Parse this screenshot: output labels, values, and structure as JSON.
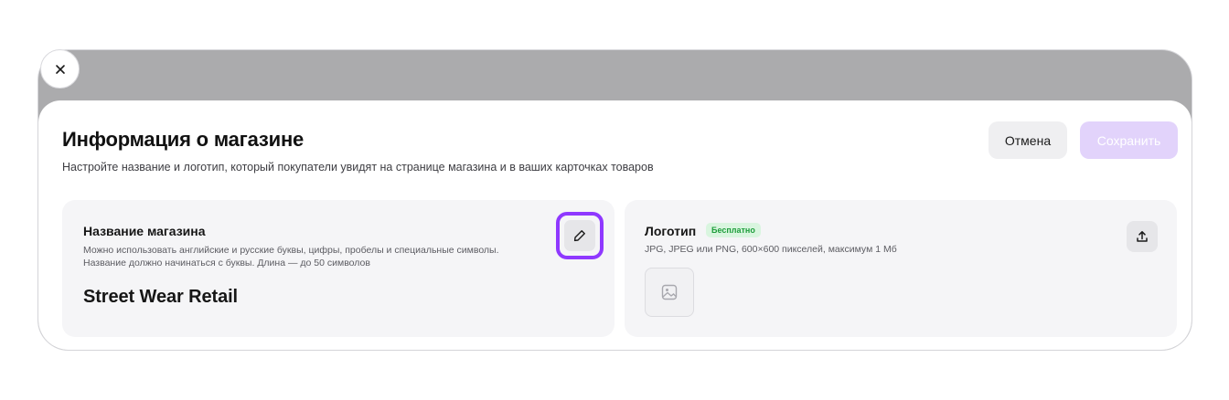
{
  "close": {
    "icon": "close-icon"
  },
  "header": {
    "title": "Информация о магазине",
    "subtitle": "Настройте название и логотип, который покупатели увидят на странице магазина и в ваших карточках товаров",
    "cancel_label": "Отмена",
    "save_label": "Сохранить"
  },
  "name_card": {
    "title": "Название магазина",
    "hint": "Можно использовать английские и русские буквы, цифры, пробелы и специальные символы. Название должно начинаться с буквы. Длина — до 50 символов",
    "value": "Street Wear Retail",
    "edit_icon": "pencil-icon"
  },
  "logo_card": {
    "title": "Логотип",
    "badge": "Бесплатно",
    "hint": "JPG, JPEG или PNG, 600×600 пикселей, максимум 1 Мб",
    "placeholder_icon": "image-icon",
    "upload_icon": "upload-icon"
  },
  "colors": {
    "accent": "#8f38ff",
    "save_disabled": "#e2d3fb",
    "badge_bg": "#d9f5df",
    "badge_text": "#1f9e3c",
    "overlay": "#ababad"
  }
}
